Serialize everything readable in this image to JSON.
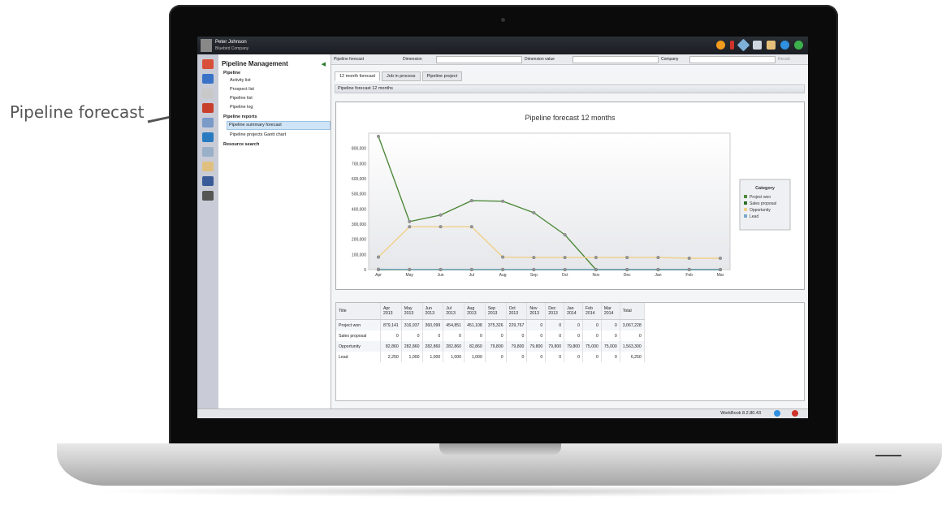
{
  "callout": {
    "label": "Pipeline forecast"
  },
  "user": {
    "name": "Peter Johnson",
    "company": "Bluebird Company"
  },
  "nav": {
    "title": "Pipeline Management",
    "sections": [
      {
        "label": "Pipeline",
        "items": [
          "Activity list",
          "Prospect list",
          "Pipeline list",
          "Pipeline log"
        ]
      },
      {
        "label": "Pipeline reports",
        "items": [
          "Pipeline summary forecast",
          "Pipeline projects Gantt chart"
        ]
      },
      {
        "label": "Resource search",
        "items": []
      }
    ],
    "selected": "Pipeline summary forecast"
  },
  "filters": {
    "view_label": "Pipeline forecast",
    "dimension_label": "Dimension",
    "dimension_value_label": "Dimension value",
    "company_label": "Company",
    "recalc_label": "Recalc"
  },
  "tabs": [
    "12 month forecast",
    "Job in process",
    "Pipeline project"
  ],
  "subheader": "Pipeline forecast 12 months",
  "status": {
    "version": "WorkBook 8.2.80.43"
  },
  "colors": {
    "project_won": "#4e8a3a",
    "sales_proposal": "#2f6e2b",
    "opportunity": "#f0d08a",
    "lead": "#7aa8c8"
  },
  "chart_data": {
    "type": "line",
    "title": "Pipeline forecast 12 months",
    "categories": [
      "Apr",
      "May",
      "Jun",
      "Jul",
      "Aug",
      "Sep",
      "Oct",
      "Nov",
      "Dec",
      "Jan",
      "Feb",
      "Mar"
    ],
    "yticks": [
      "0",
      "100,000",
      "200,000",
      "300,000",
      "400,000",
      "500,000",
      "600,000",
      "700,000",
      "800,000"
    ],
    "ylim": [
      0,
      900000
    ],
    "legend_title": "Category",
    "legend_position": "right",
    "series": [
      {
        "name": "Project won",
        "values": [
          879141,
          316937,
          360099,
          454851,
          451108,
          375326,
          229767,
          0,
          0,
          0,
          0,
          0
        ]
      },
      {
        "name": "Sales proposal",
        "values": [
          0,
          0,
          0,
          0,
          0,
          0,
          0,
          0,
          0,
          0,
          0,
          0
        ]
      },
      {
        "name": "Opportunity",
        "values": [
          82860,
          282860,
          282860,
          282860,
          82860,
          79800,
          79800,
          79800,
          79800,
          79800,
          75000,
          75000
        ]
      },
      {
        "name": "Lead",
        "values": [
          2250,
          1000,
          1000,
          1000,
          1000,
          0,
          0,
          0,
          0,
          0,
          0,
          0
        ]
      }
    ]
  },
  "table": {
    "headers": [
      [
        "Title",
        ""
      ],
      [
        "Apr",
        "2013"
      ],
      [
        "May",
        "2013"
      ],
      [
        "Jun",
        "2013"
      ],
      [
        "Jul",
        "2013"
      ],
      [
        "Aug",
        "2013"
      ],
      [
        "Sep",
        "2013"
      ],
      [
        "Oct",
        "2013"
      ],
      [
        "Nov",
        "2013"
      ],
      [
        "Dec",
        "2013"
      ],
      [
        "Jan",
        "2014"
      ],
      [
        "Feb",
        "2014"
      ],
      [
        "Mar",
        "2014"
      ],
      [
        "Total",
        ""
      ]
    ],
    "rows": [
      [
        "Project won",
        "879,141",
        "316,937",
        "360,099",
        "454,851",
        "451,108",
        "375,326",
        "229,767",
        "0",
        "0",
        "0",
        "0",
        "0",
        "3,067,228"
      ],
      [
        "Sales proposal",
        "0",
        "0",
        "0",
        "0",
        "0",
        "0",
        "0",
        "0",
        "0",
        "0",
        "0",
        "0",
        "0"
      ],
      [
        "Opportunity",
        "82,860",
        "282,860",
        "282,860",
        "282,860",
        "82,860",
        "79,800",
        "79,800",
        "79,800",
        "79,800",
        "79,800",
        "75,000",
        "75,000",
        "1,563,300"
      ],
      [
        "Lead",
        "2,250",
        "1,000",
        "1,000",
        "1,000",
        "1,000",
        "0",
        "0",
        "0",
        "0",
        "0",
        "0",
        "0",
        "6,250"
      ]
    ]
  }
}
